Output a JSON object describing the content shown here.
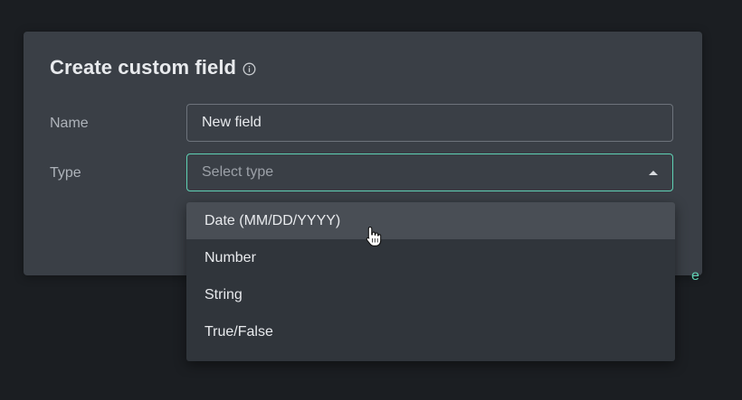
{
  "dialog": {
    "title": "Create custom field",
    "title_icon": "info-icon",
    "name_label": "Name",
    "name_value": "New field",
    "type_label": "Type",
    "type_placeholder": "Select type",
    "type_caret_icon": "chevron-up-icon",
    "partial_button_text": "e"
  },
  "type_menu": {
    "options": [
      {
        "label": "Date (MM/DD/YYYY)",
        "hovered": true
      },
      {
        "label": "Number",
        "hovered": false
      },
      {
        "label": "String",
        "hovered": false
      },
      {
        "label": "True/False",
        "hovered": false
      }
    ]
  },
  "colors": {
    "accent": "#5fd1b4",
    "background": "#1b1e22",
    "dialog": "#3a3f46",
    "menu": "#30353b",
    "menu_hover": "#494e55"
  }
}
